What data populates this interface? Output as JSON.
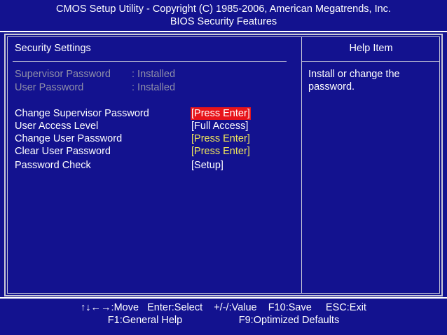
{
  "header": {
    "line1": "CMOS Setup Utility - Copyright (C) 1985-2006, American Megatrends, Inc.",
    "line2": "BIOS Security Features"
  },
  "left_panel": {
    "title": "Security Settings",
    "status": [
      {
        "label": "Supervisor Password",
        "value": ": Installed"
      },
      {
        "label": "User Password",
        "value": ": Installed"
      }
    ],
    "settings": [
      {
        "label": "Change Supervisor Password",
        "value": "[Press Enter]",
        "state": "selected"
      },
      {
        "label": "User Access Level",
        "value": "[Full Access]",
        "state": "white"
      },
      {
        "label": "Change User Password",
        "value": "[Press Enter]",
        "state": "yellow"
      },
      {
        "label": "Clear User Password",
        "value": "[Press Enter]",
        "state": "yellow"
      },
      {
        "label": "Password Check",
        "value": "[Setup]",
        "state": "white"
      }
    ]
  },
  "help_panel": {
    "title": "Help Item",
    "text": "Install or change the password."
  },
  "footer": {
    "line1": "↑↓←→:Move   Enter:Select    +/-/:Value    F10:Save     ESC:Exit",
    "line2": "F1:General Help                    F9:Optimized Defaults"
  },
  "colors": {
    "background": "#13128f",
    "selected_bg": "#e8141a",
    "value_yellow": "#f2e85a",
    "inactive_text": "#8f8fa8"
  }
}
